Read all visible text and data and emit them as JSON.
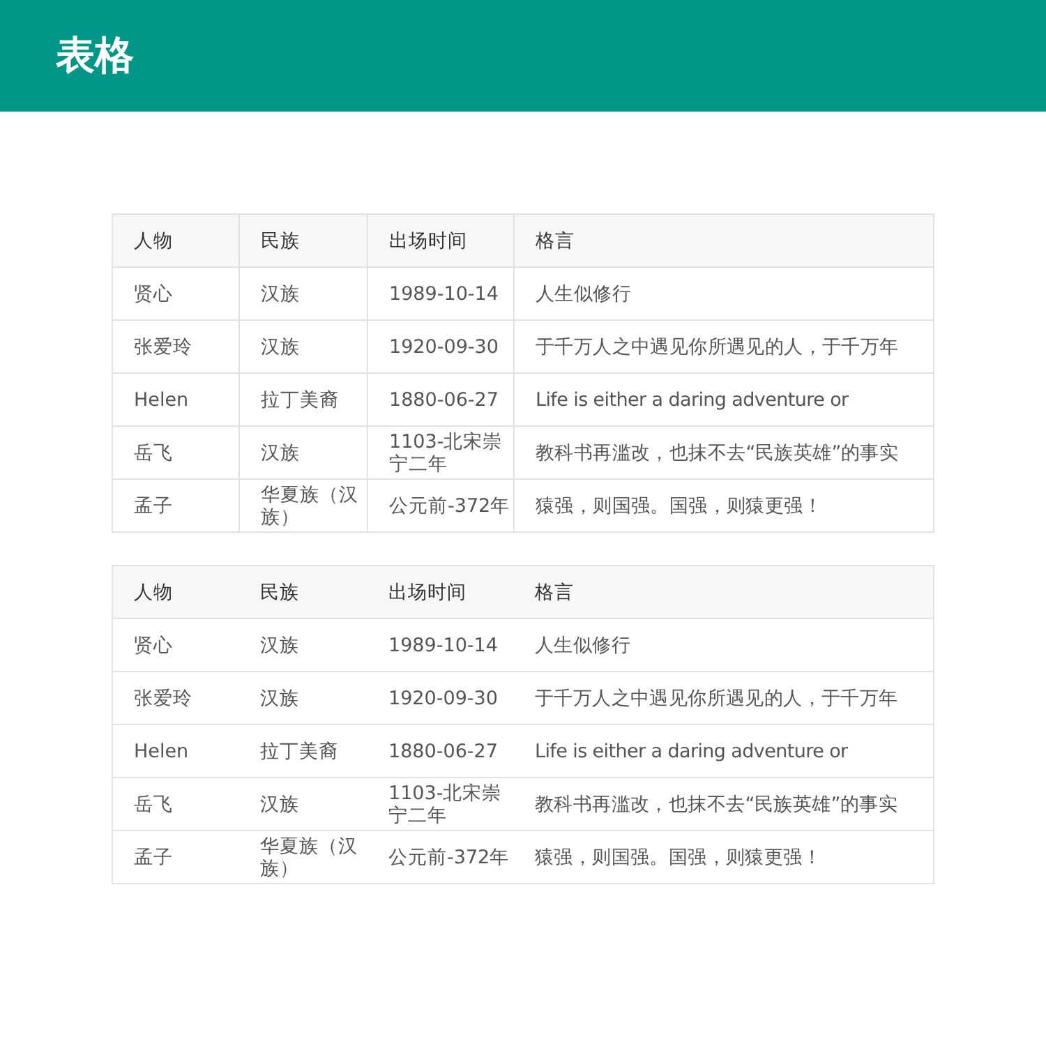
{
  "header": {
    "title": "表格"
  },
  "tables": [
    {
      "kind": "bordered",
      "columns": [
        "人物",
        "民族",
        "出场时间",
        "格言"
      ],
      "rows": [
        [
          "贤心",
          "汉族",
          "1989-10-14",
          "人生似修行"
        ],
        [
          "张爱玲",
          "汉族",
          "1920-09-30",
          "于千万人之中遇见你所遇见的人，于千万年"
        ],
        [
          "Helen",
          "拉丁美裔",
          "1880-06-27",
          "Life is either a daring adventure or"
        ],
        [
          "岳飞",
          "汉族",
          "1103-北宋崇宁二年",
          "教科书再滥改，也抹不去“民族英雄”的事实"
        ],
        [
          "孟子",
          "华夏族（汉族）",
          "公元前-372年",
          "猿强，则国强。国强，则猿更强！"
        ]
      ]
    },
    {
      "kind": "lined",
      "columns": [
        "人物",
        "民族",
        "出场时间",
        "格言"
      ],
      "rows": [
        [
          "贤心",
          "汉族",
          "1989-10-14",
          "人生似修行"
        ],
        [
          "张爱玲",
          "汉族",
          "1920-09-30",
          "于千万人之中遇见你所遇见的人，于千万年"
        ],
        [
          "Helen",
          "拉丁美裔",
          "1880-06-27",
          "Life is either a daring adventure or"
        ],
        [
          "岳飞",
          "汉族",
          "1103-北宋崇宁二年",
          "教科书再滥改，也抹不去“民族英雄”的事实"
        ],
        [
          "孟子",
          "华夏族（汉族）",
          "公元前-372年",
          "猿强，则国强。国强，则猿更强！"
        ]
      ]
    }
  ]
}
